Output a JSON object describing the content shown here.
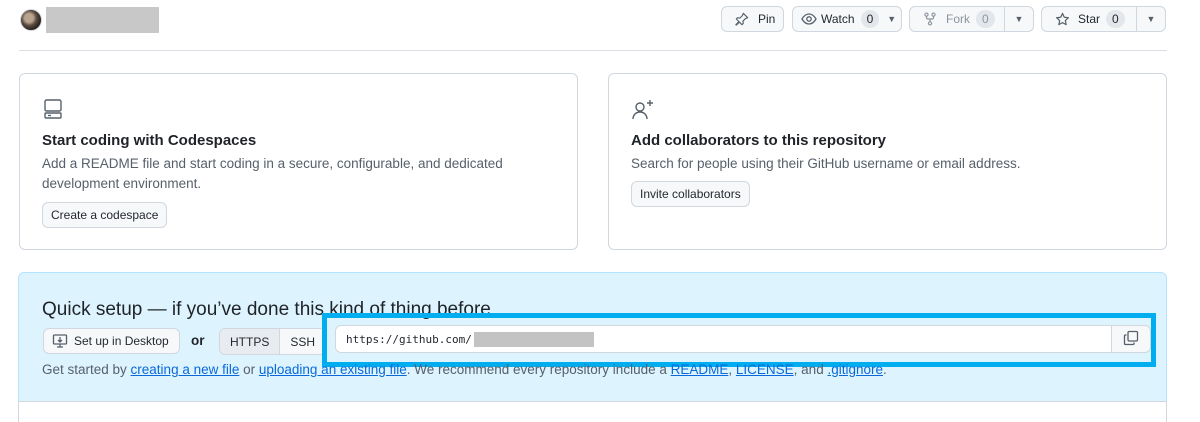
{
  "header": {
    "pin": "Pin",
    "watch": "Watch",
    "watch_count": "0",
    "fork": "Fork",
    "fork_count": "0",
    "star": "Star",
    "star_count": "0"
  },
  "codespaces": {
    "title": "Start coding with Codespaces",
    "description": "Add a README file and start coding in a secure, configurable, and dedicated development environment.",
    "button": "Create a codespace"
  },
  "collaborators": {
    "title": "Add collaborators to this repository",
    "description": "Search for people using their GitHub username or email address.",
    "button": "Invite collaborators"
  },
  "quick_setup": {
    "title": "Quick setup — if you’ve done this kind of thing before",
    "desktop_button": "Set up in Desktop",
    "or": "or",
    "https": "HTTPS",
    "ssh": "SSH",
    "url": "https://github.com/",
    "get_started": {
      "prefix": "Get started by ",
      "link1": "creating a new file",
      "mid1": " or ",
      "link2": "uploading an existing file",
      "mid2": ". We recommend every repository include a ",
      "link3": "README",
      "sep1": ", ",
      "link4": "LICENSE",
      "sep2": ", and ",
      "link5": ".gitignore",
      "suffix": "."
    }
  },
  "colors": {
    "link": "#0969da",
    "highlight": "#00aeef",
    "quick_bg": "#ddf4ff"
  }
}
